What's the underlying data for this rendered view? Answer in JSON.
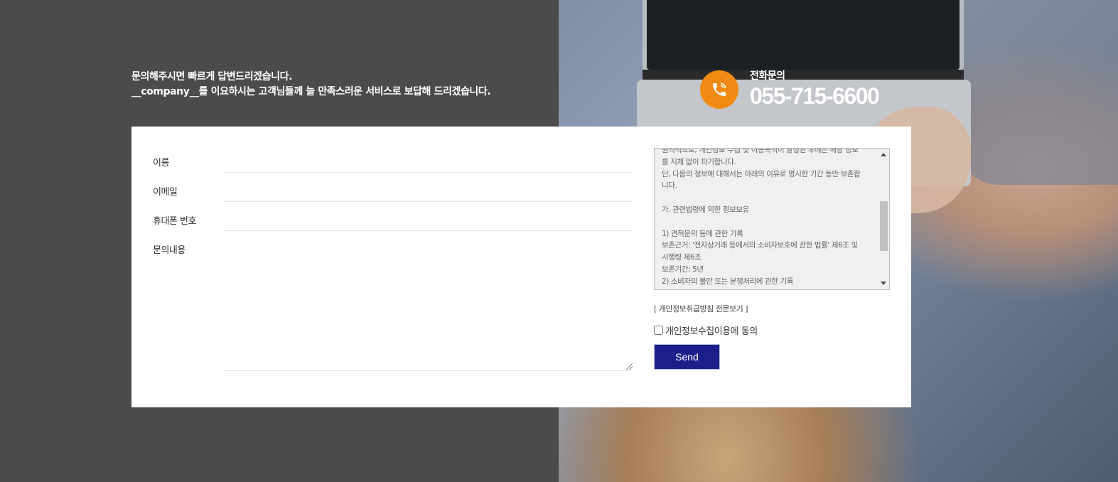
{
  "intro": {
    "line1": "문의해주시면 빠르게 답변드리겠습니다.",
    "line2": "__company__를 이요하시는 고객님들께 늘 만족스러운 서비스로 보답해 드리겠습니다."
  },
  "contact": {
    "label": "전화문의",
    "phone": "055-715-6600",
    "icon": "phone-icon",
    "accent_color": "#f08a12"
  },
  "form": {
    "fields": [
      {
        "label": "이름",
        "value": "",
        "placeholder": ""
      },
      {
        "label": "이메일",
        "value": "",
        "placeholder": ""
      },
      {
        "label": "휴대폰 번호",
        "value": "",
        "placeholder": ""
      },
      {
        "label": "문의내용",
        "value": "",
        "placeholder": ""
      }
    ]
  },
  "privacy": {
    "lines": [
      "원칙적으로, 개인정보 수집 및 이용목적이 달성된 후에는 해당 정보",
      "를 지체 없이 파기합니다.",
      "단, 다음의 정보에 대해서는 아래의 이유로 명시한 기간 동안 보존합",
      "니다.",
      "",
      "가. 관련법령에 의한 정보보유",
      "",
      "1) 견적문의 등에 관한 기록",
      "보존근거: '전자상거래 등에서의 소비자보호에 관한 법률' 제6조 및",
      "시행령 제6조",
      "보존기간: 5년",
      "2) 소비자의 불만 또는 분쟁처리에 관한 기록"
    ],
    "link_label": "[ 개인정보취급방침 전문보기 ]",
    "agree_label": "개인정보수집이용에 동의",
    "agree_checked": false
  },
  "send": {
    "label": "Send",
    "color": "#1c1f8a"
  }
}
